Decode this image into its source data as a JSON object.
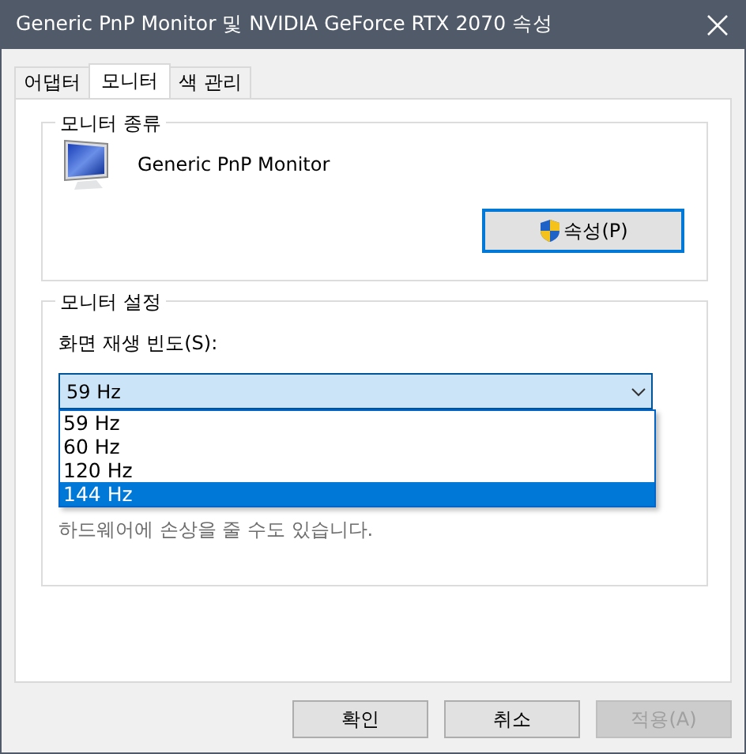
{
  "window": {
    "title": "Generic PnP Monitor 및 NVIDIA GeForce RTX 2070 속성"
  },
  "tabs": [
    {
      "label": "어댑터",
      "selected": false
    },
    {
      "label": "모니터",
      "selected": true
    },
    {
      "label": "색 관리",
      "selected": false
    }
  ],
  "monitor_type": {
    "legend": "모니터 종류",
    "name": "Generic PnP Monitor",
    "properties_button": "속성(P)"
  },
  "monitor_settings": {
    "legend": "모니터 설정",
    "refresh_label": "화면 재생 빈도(S):",
    "refresh_value": "59 Hz",
    "expanded": true,
    "options": [
      {
        "label": "59 Hz",
        "selected": false
      },
      {
        "label": "60 Hz",
        "selected": false
      },
      {
        "label": "120 Hz",
        "selected": false
      },
      {
        "label": "144 Hz",
        "selected": true
      }
    ],
    "note": "하드웨어에 손상을 줄 수도 있습니다."
  },
  "buttons": [
    {
      "label": "확인",
      "disabled": false
    },
    {
      "label": "취소",
      "disabled": false
    },
    {
      "label": "적용(A)",
      "disabled": true
    }
  ]
}
